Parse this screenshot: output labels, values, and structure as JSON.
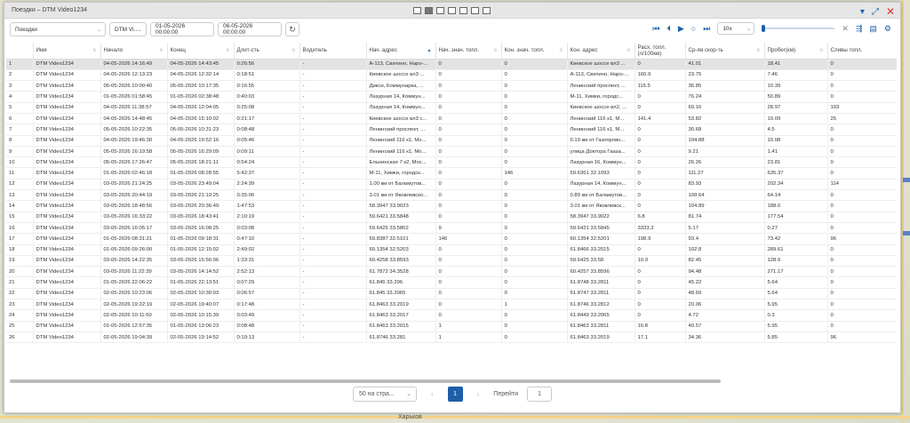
{
  "map": {
    "label_bottom": "Харьков"
  },
  "window": {
    "title": "Поездки – DTM Video1234",
    "controls": {
      "collapse": "▾",
      "expand": "⤢",
      "close": "✕"
    }
  },
  "toolbar": {
    "report_type": "Поездки",
    "unit": "DTM Vi...",
    "date_from": "01-05-2026 00:00:00",
    "date_to": "06-05-2026 00:00:00",
    "refresh_icon": "refresh-icon",
    "player": {
      "speed": "10x"
    }
  },
  "columns": [
    "",
    "Имя",
    "Начало",
    "Конец",
    "Длит-сть",
    "Водитель",
    "Нач. адрес",
    "Нач. знач. топл.",
    "Кон. знач. топл.",
    "Кон. адрес",
    "Расх. топл. (л/100км)",
    "Ср-яя скор-ть",
    "Пробег(км)",
    "Сливы топл."
  ],
  "rows": [
    [
      "1",
      "DTM Video1234",
      "04-05-2026 14:16:49",
      "04-05-2026 14:43:45",
      "0:26:56",
      "-",
      "A-113, Свитино, Наро-...",
      "0",
      "0",
      "Киевское шоссе вл3 ...",
      "0",
      "41.01",
      "18.41",
      "0"
    ],
    [
      "2",
      "DTM Video1234",
      "04-05-2026 12:13:23",
      "04-05-2026 12:32:14",
      "0:18:51",
      "-",
      "Киевское шоссе вл3 ...",
      "0",
      "0",
      "A-113, Свитино, Наро-...",
      "160.9",
      "23.75",
      "7.46",
      "0"
    ],
    [
      "3",
      "DTM Video1234",
      "05-05-2026 10:00:40",
      "05-05-2026 10:17:35",
      "0:16:55",
      "-",
      "Дикси, Коммунарка, ...",
      "0",
      "0",
      "Ленинский проспект, ...",
      "115.5",
      "36.85",
      "10.39",
      "0"
    ],
    [
      "4",
      "DTM Video1234",
      "01-05-2026 01:58:45",
      "01-05-2026 02:38:48",
      "0:40:03",
      "-",
      "Лазурная 14, Коммун...",
      "0",
      "0",
      "М-11, Химки, городс...",
      "0",
      "76.24",
      "50.89",
      "0"
    ],
    [
      "5",
      "DTM Video1234",
      "04-05-2026 11:38:57",
      "04-05-2026 12:04:05",
      "0:25:08",
      "-",
      "Лазурная 14, Коммун...",
      "0",
      "0",
      "Киевское шоссе вл2, ...",
      "0",
      "69.16",
      "28.97",
      "103"
    ],
    [
      "6",
      "DTM Video1234",
      "04-05-2026 14:48:45",
      "04-05-2026 15:10:02",
      "0:21:17",
      "-",
      "Киевское шоссе вл3 с...",
      "0",
      "0",
      "Ленинский 116 к1, М...",
      "141.4",
      "53.82",
      "19.09",
      "25"
    ],
    [
      "7",
      "DTM Video1234",
      "05-05-2026 10:22:35",
      "05-05-2026 10:31:23",
      "0:08:48",
      "-",
      "Ленинский проспект, ...",
      "0",
      "0",
      "Ленинский 116 к1, М...",
      "0",
      "30.68",
      "4.5",
      "0"
    ],
    [
      "8",
      "DTM Video1234",
      "04-05-2026 19:46:30",
      "04-05-2026 19:52:16",
      "0:05:46",
      "-",
      "Ленинский 116 к1, Мо...",
      "0",
      "0",
      "0.19 км от Газопрово...",
      "0",
      "104.88",
      "10.08",
      "0"
    ],
    [
      "9",
      "DTM Video1234",
      "05-05-2026 16:19:58",
      "05-05-2026 16:29:09",
      "0:09:11",
      "-",
      "Ленинский 116 к1, Мо...",
      "0",
      "0",
      "улица Доктора Гааза...",
      "0",
      "9.21",
      "1.41",
      "0"
    ],
    [
      "10",
      "DTM Video1234",
      "05-05-2026 17:26:47",
      "05-05-2026 18:21:11",
      "0:54:24",
      "-",
      "Ельнинская 7 к2, Мос...",
      "0",
      "0",
      "Лазурная 16, Коммун...",
      "0",
      "26.26",
      "23.81",
      "0"
    ],
    [
      "11",
      "DTM Video1234",
      "01-05-2026 02:46:18",
      "01-05-2026 08:28:55",
      "5:42:37",
      "-",
      "М-11, Химки, городск...",
      "0",
      "146",
      "59.6361 32.1093",
      "0",
      "111.27",
      "635.37",
      "0"
    ],
    [
      "12",
      "DTM Video1234",
      "03-05-2026 21:24:25",
      "03-05-2026 23:49:04",
      "2:24:39",
      "-",
      "1.00 км от Баламутов...",
      "0",
      "0",
      "Лазурная 14, Коммун...",
      "0",
      "83.93",
      "202.34",
      "114"
    ],
    [
      "13",
      "DTM Video1234",
      "03-05-2026 20:44:19",
      "03-05-2026 21:19:25",
      "0:35:06",
      "-",
      "3.01 км от Яковлевско...",
      "0",
      "0",
      "0.89 км от Баламутов...",
      "0",
      "109.64",
      "64.14",
      "0"
    ],
    [
      "14",
      "DTM Video1234",
      "03-05-2026 18:48:56",
      "03-05-2026 20:36:49",
      "1:47:53",
      "-",
      "58.3947 33.9023",
      "0",
      "0",
      "3.01 км от Яковлевск...",
      "0",
      "104.89",
      "188.6",
      "0"
    ],
    [
      "15",
      "DTM Video1234",
      "03-05-2026 16:33:22",
      "03-05-2026 18:43:41",
      "2:10:19",
      "-",
      "59.6421 33.5848",
      "0",
      "0",
      "58.3947 33.9022",
      "6.8",
      "81.74",
      "177.54",
      "0"
    ],
    [
      "16",
      "DTM Video1234",
      "03-05-2026 16:05:17",
      "03-05-2026 16:08:25",
      "0:03:08",
      "-",
      "59.6425 33.5802",
      "9",
      "0",
      "59.6421 33.5845",
      "3333.3",
      "5.17",
      "0.27",
      "0"
    ],
    [
      "17",
      "DTM Video1234",
      "01-05-2026 08:31:21",
      "01-05-2026 09:18:31",
      "0:47:10",
      "-",
      "59.8387 32.5101",
      "146",
      "0",
      "60.1354 32.5201",
      "198.9",
      "93.4",
      "73.42",
      "96"
    ],
    [
      "18",
      "DTM Video1234",
      "01-05-2026 09:26:00",
      "01-05-2026 12:15:02",
      "2:49:02",
      "-",
      "60.1354 32.5203",
      "0",
      "0",
      "61.8466 33.2015",
      "0",
      "102.8",
      "289.61",
      "0"
    ],
    [
      "19",
      "DTM Video1234",
      "03-05-2026 14:22:35",
      "03-05-2026 15:56:06",
      "1:33:31",
      "-",
      "60.4258 33.8593",
      "0",
      "0",
      "59.6425 33.58",
      "10.9",
      "82.45",
      "128.9",
      "0"
    ],
    [
      "20",
      "DTM Video1234",
      "03-05-2026 11:22:39",
      "03-05-2026 14:14:52",
      "2:52:13",
      "-",
      "61.7872 34.3528",
      "0",
      "0",
      "60.4257 33.8596",
      "0",
      "94.48",
      "271.17",
      "0"
    ],
    [
      "21",
      "DTM Video1234",
      "01-05-2026 22:06:22",
      "01-05-2026 22:13:51",
      "0:07:29",
      "-",
      "61.845 33.206",
      "0",
      "0",
      "61.8748 33.2811",
      "0",
      "45.22",
      "5.64",
      "0"
    ],
    [
      "22",
      "DTM Video1234",
      "02-05-2026 10:23:06",
      "02-05-2026 10:30:03",
      "0:06:57",
      "-",
      "61.845 33.2065",
      "0",
      "0",
      "61.8747 33.2811",
      "0",
      "48.69",
      "5.64",
      "0"
    ],
    [
      "23",
      "DTM Video1234",
      "02-05-2026 19:22:19",
      "02-05-2026 19:40:07",
      "0:17:48",
      "-",
      "61.8463 33.2019",
      "0",
      "1",
      "61.8746 33.2812",
      "0",
      "20.06",
      "5.95",
      "0"
    ],
    [
      "24",
      "DTM Video1234",
      "02-05-2026 10:11:50",
      "02-05-2026 10:15:39",
      "0:03:49",
      "-",
      "61.8463 33.2017",
      "0",
      "0",
      "61.8449 33.2065",
      "0",
      "4.72",
      "0.3",
      "0"
    ],
    [
      "25",
      "DTM Video1234",
      "01-05-2026 12:57:35",
      "01-05-2026 13:06:23",
      "0:08:48",
      "-",
      "61.8463 33.2015",
      "1",
      "0",
      "61.8463 33.2811",
      "16.8",
      "40.57",
      "5.95",
      "0"
    ],
    [
      "26",
      "DTM Video1234",
      "02-05-2026 19:04:39",
      "02-05-2026 19:14:52",
      "0:10:13",
      "-",
      "61.8746 33.281",
      "1",
      "0",
      "61.8463 33.2019",
      "17.1",
      "34.36",
      "5.85",
      "96"
    ]
  ],
  "pager": {
    "page_size": "50 на стра...",
    "current_page": "1",
    "goto_label": "Перейти",
    "goto_value": "1"
  }
}
